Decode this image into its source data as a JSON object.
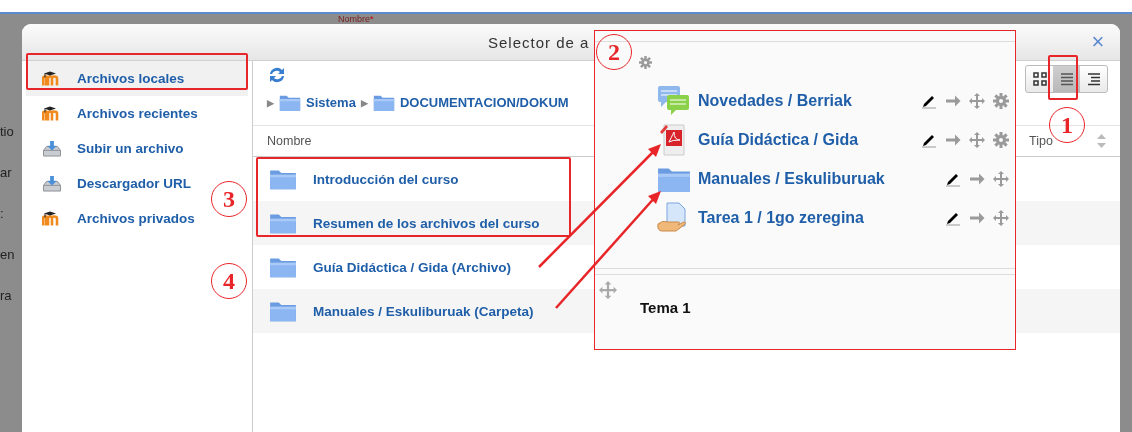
{
  "background": {
    "label": "Nombre",
    "required_mark": "*",
    "fragments": [
      "tio",
      "ar",
      ":",
      "en",
      "ra"
    ]
  },
  "dialog": {
    "title": "Selector de a",
    "close_glyph": "×",
    "sidebar": [
      {
        "label": "Archivos locales",
        "kind": "moodle",
        "selected": true
      },
      {
        "label": "Archivos recientes",
        "kind": "moodle",
        "selected": false
      },
      {
        "label": "Subir un archivo",
        "kind": "upload",
        "selected": false
      },
      {
        "label": "Descargador URL",
        "kind": "upload",
        "selected": false
      },
      {
        "label": "Archivos privados",
        "kind": "moodle",
        "selected": false
      }
    ],
    "breadcrumb": [
      {
        "separator": "▶",
        "label": "Sistema"
      },
      {
        "separator": "▶",
        "label": "DOCUMENTACION/DOKUM"
      }
    ],
    "view_modes": [
      {
        "kind": "icons",
        "selected": false
      },
      {
        "kind": "list",
        "selected": true
      },
      {
        "kind": "tree",
        "selected": false
      }
    ],
    "columns": [
      "Nombre",
      "Tipo"
    ],
    "rows": [
      {
        "name": "Introducción del curso"
      },
      {
        "name": "Resumen de los archivos del curso"
      },
      {
        "name": "Guía Didáctica / Gida (Archivo)"
      },
      {
        "name": "Manuales / Eskuliburuak (Carpeta)"
      }
    ]
  },
  "course_panel": {
    "activities": [
      {
        "name": "Novedades / Berriak",
        "kind": "forum",
        "actions": [
          {
            "kind": "edit"
          },
          {
            "kind": "move-right"
          },
          {
            "kind": "move"
          },
          {
            "kind": "settings"
          }
        ]
      },
      {
        "name": "Guía Didáctica / Gida",
        "kind": "pdf",
        "actions": [
          {
            "kind": "edit"
          },
          {
            "kind": "move-right"
          },
          {
            "kind": "move"
          },
          {
            "kind": "settings"
          }
        ]
      },
      {
        "name": "Manuales / Eskuliburuak",
        "kind": "folder",
        "actions": [
          {
            "kind": "edit"
          },
          {
            "kind": "move-right"
          },
          {
            "kind": "move"
          }
        ]
      },
      {
        "name": "Tarea 1 / 1go zeregina",
        "kind": "assignment",
        "actions": [
          {
            "kind": "edit"
          },
          {
            "kind": "move-right"
          },
          {
            "kind": "move"
          }
        ]
      }
    ],
    "section_title": "Tema 1"
  },
  "annotations": [
    {
      "label": "1"
    },
    {
      "label": "2"
    },
    {
      "label": "3"
    },
    {
      "label": "4"
    }
  ]
}
